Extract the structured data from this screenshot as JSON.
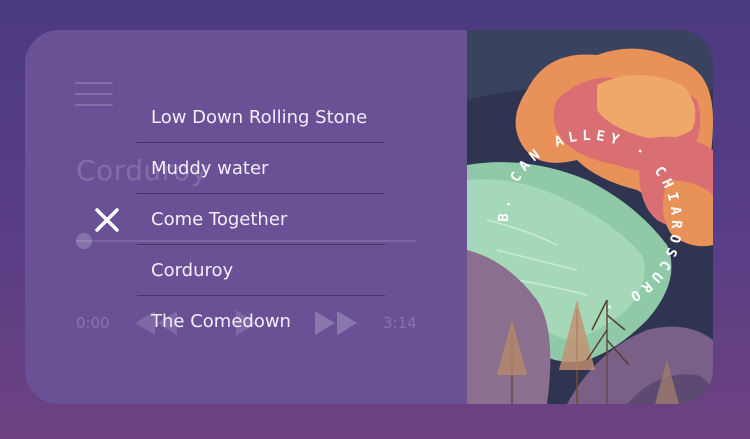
{
  "player": {
    "current_title": "Corduroy",
    "time_elapsed": "0:00",
    "time_total": "3:14",
    "progress": 0
  },
  "playlist": {
    "tracks": [
      {
        "label": "Low Down Rolling Stone"
      },
      {
        "label": "Muddy water"
      },
      {
        "label": "Come Together"
      },
      {
        "label": "Corduroy"
      },
      {
        "label": "The Comedown"
      }
    ],
    "close_icon": "close-icon"
  },
  "album_art": {
    "ring_text": "B. CAN ALLEY · CHIAROSCURO ·",
    "colors": {
      "sky": "#2f3550",
      "cloud_orange": "#e8925a",
      "cloud_pink": "#d96f73",
      "river": "#8fc9a8",
      "hills": "#8a6f8f"
    }
  },
  "colors": {
    "background": "#4b3a7e",
    "card": "#6a5196",
    "text": "#f2eefa"
  }
}
